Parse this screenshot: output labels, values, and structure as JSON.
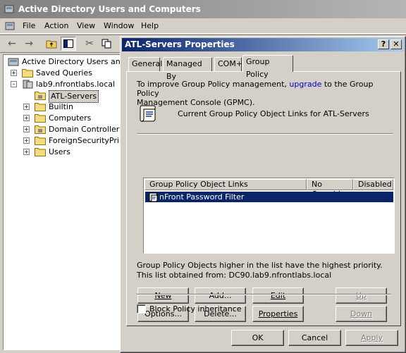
{
  "main_window": {
    "title": "Active Directory Users and Computers",
    "menu": [
      "File",
      "Action",
      "View",
      "Window",
      "Help"
    ]
  },
  "toolbar": {
    "icons": [
      "back-arrow-icon",
      "forward-arrow-icon",
      "up-folder-icon",
      "show-hide-tree-icon",
      "cut-icon",
      "copy-icon"
    ]
  },
  "tree": {
    "root": "Active Directory Users and C",
    "saved_queries": "Saved Queries",
    "domain": "lab9.nfrontlabs.local",
    "selected": "ATL-Servers",
    "children": [
      "Builtin",
      "Computers",
      "Domain Controllers",
      "ForeignSecurityPrinci",
      "Users"
    ]
  },
  "dialog": {
    "title": "ATL-Servers Properties",
    "help_glyph": "?",
    "close_glyph": "✕",
    "tabs": [
      "General",
      "Managed By",
      "COM+",
      "Group Policy"
    ],
    "active_tab": "Group Policy",
    "intro_line1_prefix": "To improve Group Policy management, ",
    "intro_link": "upgrade",
    "intro_line1_suffix": " to the Group Policy",
    "intro_line2": "Management Console (GPMC).",
    "current_links_label": "Current Group Policy Object Links for ATL-Servers",
    "columns": [
      "Group Policy Object Links",
      "No Override",
      "Disabled"
    ],
    "rows": [
      {
        "name": "nFront Password Filter",
        "no_override": "",
        "disabled": ""
      }
    ],
    "priority_note": "Group Policy Objects higher in the list have the highest priority.",
    "obtained_from": "This list obtained from: DC90.lab9.nfrontlabs.local",
    "buttons": {
      "new": "New",
      "add": "Add...",
      "edit": "Edit",
      "up": "Up",
      "options": "Options...",
      "delete": "Delete...",
      "properties": "Properties",
      "down": "Down"
    },
    "block_inheritance": {
      "label": "Block Policy inheritance",
      "checked": false
    },
    "footer": {
      "ok": "OK",
      "cancel": "Cancel",
      "apply": "Apply"
    }
  },
  "colors": {
    "title_active": "#0a246a",
    "title_inactive": "#808080",
    "selection": "#0a246a",
    "face": "#d4d0c8",
    "link": "#0000cc"
  }
}
